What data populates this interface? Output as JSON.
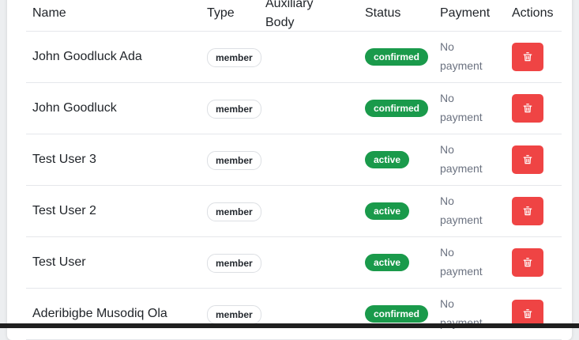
{
  "table": {
    "headers": {
      "name": "Name",
      "type": "Type",
      "auxiliary_body_line1": "Auxiliary",
      "auxiliary_body_line2": "Body",
      "status": "Status",
      "payment": "Payment",
      "actions": "Actions"
    },
    "rows": [
      {
        "name": "John Goodluck Ada",
        "type": "member",
        "auxiliary_body": "",
        "status": "confirmed",
        "payment_line1": "No",
        "payment_line2": "payment"
      },
      {
        "name": "John Goodluck",
        "type": "member",
        "auxiliary_body": "",
        "status": "confirmed",
        "payment_line1": "No",
        "payment_line2": "payment"
      },
      {
        "name": "Test User 3",
        "type": "member",
        "auxiliary_body": "",
        "status": "active",
        "payment_line1": "No",
        "payment_line2": "payment"
      },
      {
        "name": "Test User 2",
        "type": "member",
        "auxiliary_body": "",
        "status": "active",
        "payment_line1": "No",
        "payment_line2": "payment"
      },
      {
        "name": "Test User",
        "type": "member",
        "auxiliary_body": "",
        "status": "active",
        "payment_line1": "No",
        "payment_line2": "payment"
      },
      {
        "name": "Aderibigbe Musodiq Ola",
        "type": "member",
        "auxiliary_body": "",
        "status": "confirmed",
        "payment_line1": "No",
        "payment_line2": "payment"
      }
    ],
    "action_icon": "trash-icon"
  },
  "colors": {
    "status_green": "#1a9a4b",
    "delete_red": "#ef4444",
    "muted_text": "#6b7280"
  }
}
